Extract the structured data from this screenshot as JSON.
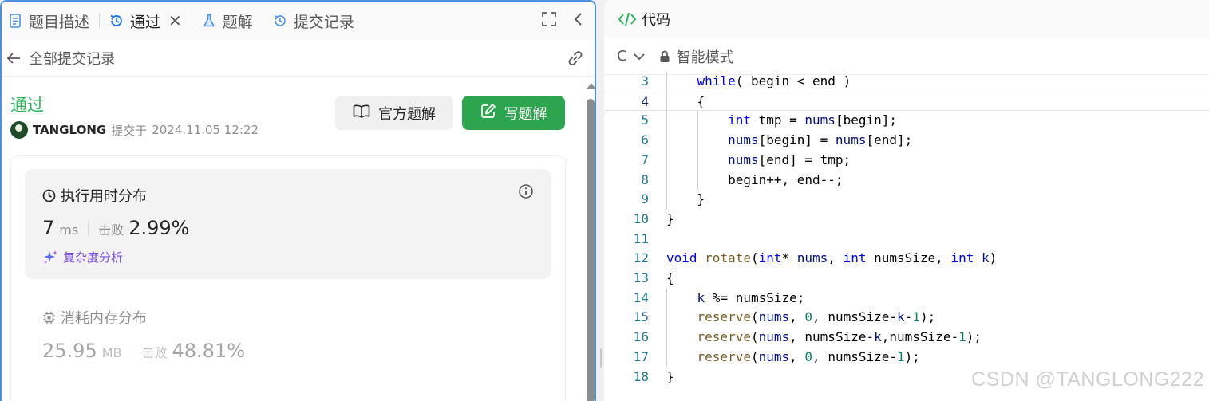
{
  "left_tabs": {
    "description": "题目描述",
    "accepted": "通过",
    "solutions": "题解",
    "submissions": "提交记录"
  },
  "subheader": {
    "back_title": "全部提交记录"
  },
  "submission": {
    "status": "通过",
    "username": "TANGLONG",
    "submitted_at_label": "提交于",
    "submitted_at": "2024.11.05 12:22",
    "status_color": "#2db55d"
  },
  "buttons": {
    "official_solution": "官方题解",
    "write_solution": "写题解",
    "write_color": "#2da44e"
  },
  "runtime": {
    "title": "执行用时分布",
    "value": "7",
    "unit": "ms",
    "beats_label": "击败",
    "beats_pct": "2.99%",
    "complexity_link": "复杂度分析"
  },
  "memory": {
    "title": "消耗内存分布",
    "value": "25.95",
    "unit": "MB",
    "beats_label": "击败",
    "beats_pct": "48.81%"
  },
  "code_panel": {
    "title": "代码",
    "language": "C",
    "mode": "智能模式"
  },
  "code_lines": [
    {
      "n": "3",
      "text": "    while( begin < end )"
    },
    {
      "n": "4",
      "text": "    {"
    },
    {
      "n": "5",
      "text": "        int tmp = nums[begin];"
    },
    {
      "n": "6",
      "text": "        nums[begin] = nums[end];"
    },
    {
      "n": "7",
      "text": "        nums[end] = tmp;"
    },
    {
      "n": "8",
      "text": "        begin++, end--;"
    },
    {
      "n": "9",
      "text": "    }"
    },
    {
      "n": "10",
      "text": "}"
    },
    {
      "n": "11",
      "text": ""
    },
    {
      "n": "12",
      "text": "void rotate(int* nums, int numsSize, int k)"
    },
    {
      "n": "13",
      "text": "{"
    },
    {
      "n": "14",
      "text": "    k %= numsSize;"
    },
    {
      "n": "15",
      "text": "    reserve(nums, 0, numsSize-k-1);"
    },
    {
      "n": "16",
      "text": "    reserve(nums, numsSize-k,numsSize-1);"
    },
    {
      "n": "17",
      "text": "    reserve(nums, 0, numsSize-1);"
    },
    {
      "n": "18",
      "text": "}"
    }
  ],
  "watermark": "CSDN @TANGLONG222"
}
